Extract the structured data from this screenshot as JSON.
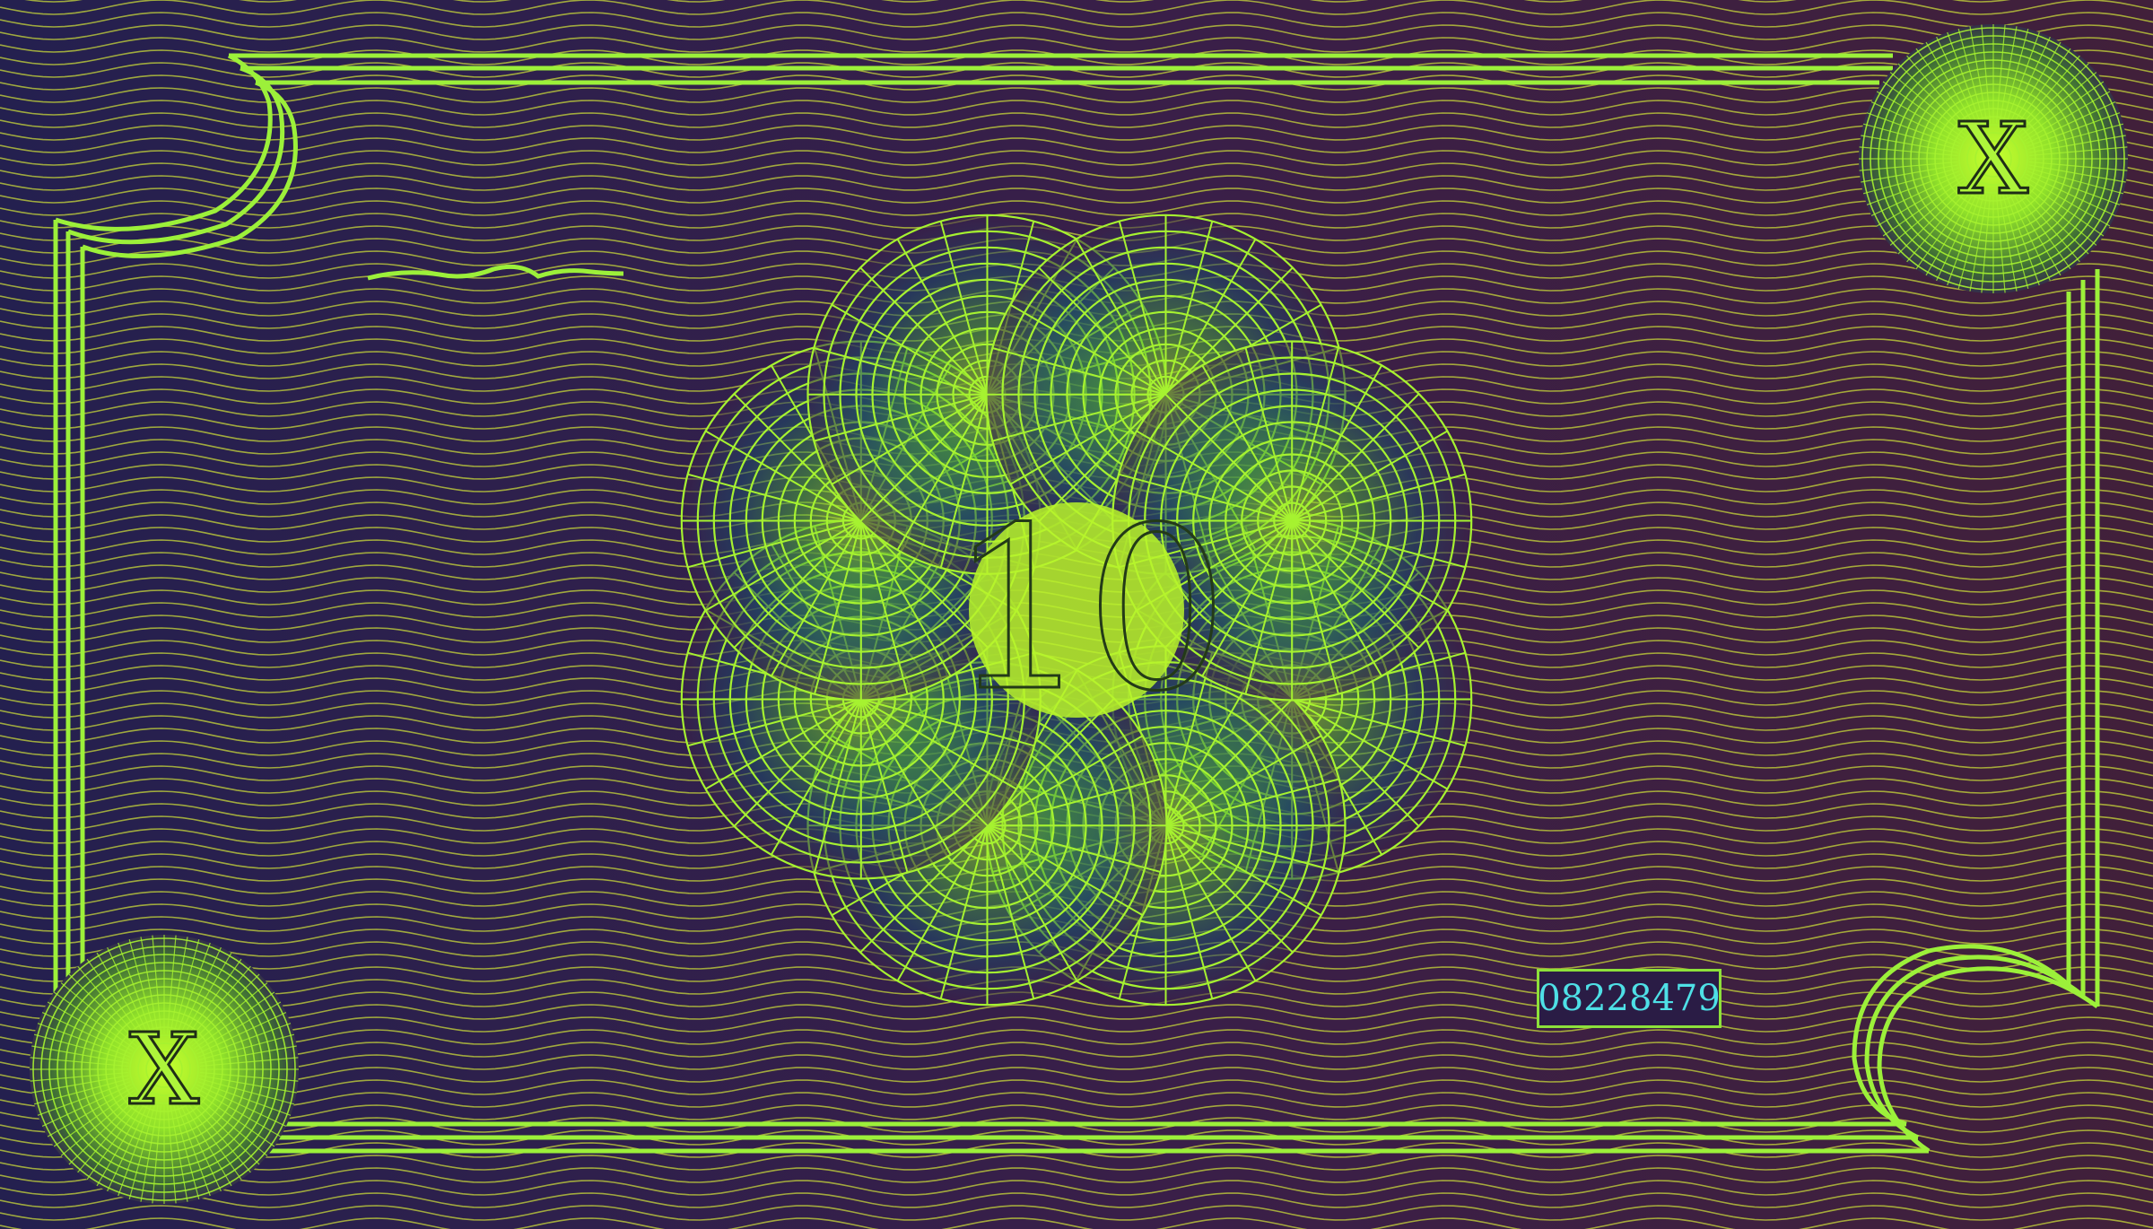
{
  "banknote": {
    "denomination": "10",
    "corner_mark_top_right": "X",
    "corner_mark_bottom_left": "X",
    "serial_number": "08228479"
  },
  "colors": {
    "background": "#2b1a4f",
    "wave_lines": "#c8d83a",
    "frame": "#9cf03a",
    "guilloche": "#a6f230",
    "serial_text": "#4ee0e6"
  }
}
